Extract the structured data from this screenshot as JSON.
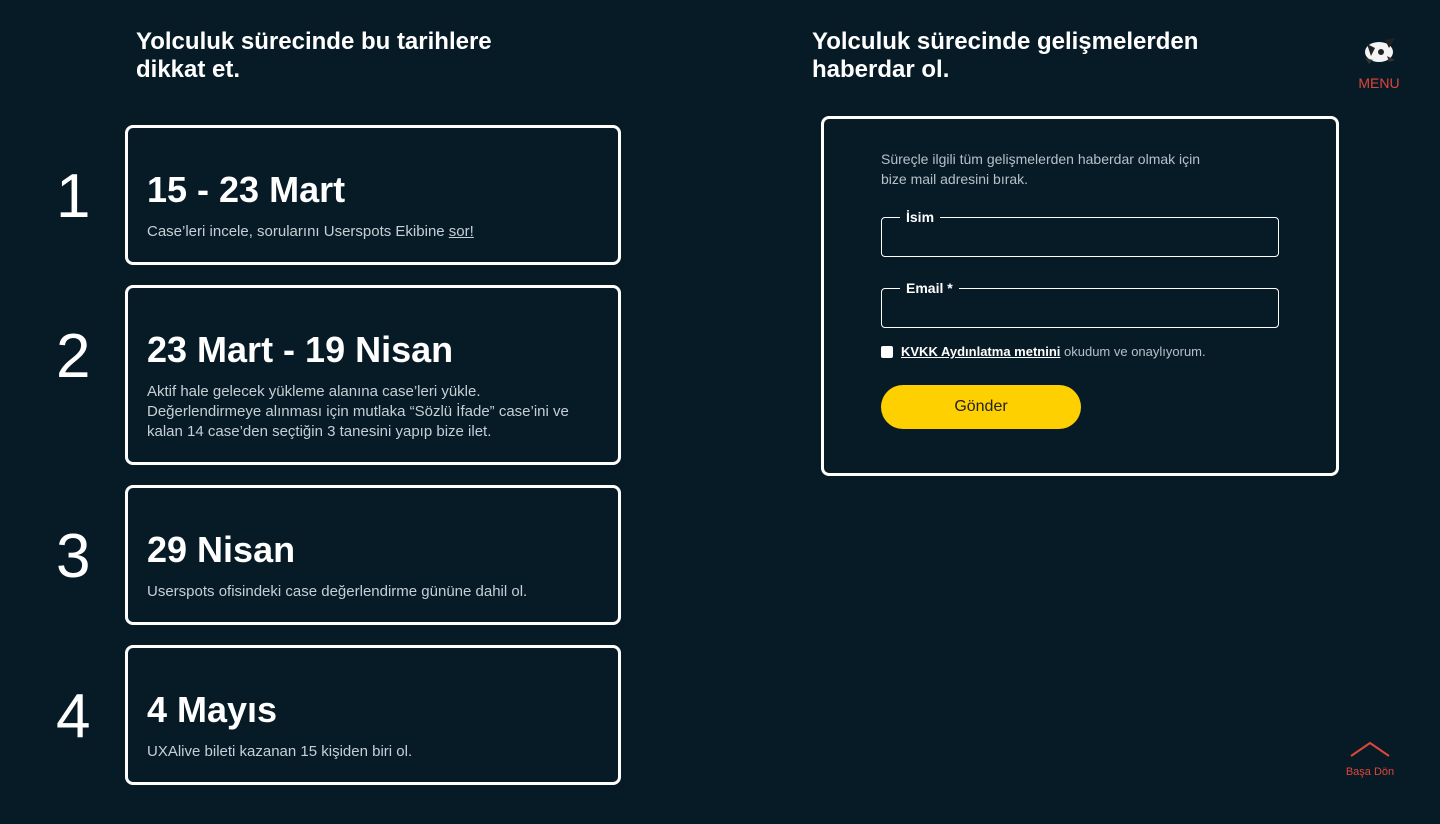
{
  "left": {
    "title_line1": "Yolculuk sürecinde bu tarihlere",
    "title_line2": "dikkat et."
  },
  "steps": [
    {
      "number": "1",
      "date": "15 - 23 Mart",
      "desc": "Case’leri incele, sorularını Userspots Ekibine ",
      "desc_link": "sor!"
    },
    {
      "number": "2",
      "date": "23 Mart - 19 Nisan",
      "desc_line1": "Aktif hale gelecek yükleme alanına case’leri yükle.",
      "desc_line2": "Değerlendirmeye alınması için mutlaka “Sözlü İfade” case’ini ve",
      "desc_line3": "kalan 14 case’den seçtiğin 3 tanesini yapıp bize ilet."
    },
    {
      "number": "3",
      "date": "29 Nisan",
      "desc": "Userspots ofisindeki case değerlendirme gününe dahil ol."
    },
    {
      "number": "4",
      "date": "4 Mayıs",
      "desc": "UXAlive bileti kazanan 15 kişiden biri ol."
    }
  ],
  "right": {
    "title_line1": "Yolculuk sürecinde gelişmelerden",
    "title_line2": "haberdar ol."
  },
  "form": {
    "intro_line1": "Süreçle ilgili  tüm gelişmelerden haberdar olmak için",
    "intro_line2": "bize mail adresini bırak.",
    "name_label": "İsim",
    "name_value": "",
    "email_label": "Email *",
    "email_value": "",
    "consent_link": "KVKK Aydınlatma metnini",
    "consent_text": " okudum ve onaylıyorum.",
    "consent_checked": false,
    "submit_label": "Gönder"
  },
  "nav": {
    "menu_label": "MENU",
    "back_to_top_label": "Başa Dön"
  },
  "colors": {
    "background": "#071b26",
    "accent_red": "#e0453a",
    "button_yellow": "#ffd000"
  },
  "icons": {
    "menu": "menu-logo-icon",
    "back_to_top": "chevron-up-icon"
  }
}
